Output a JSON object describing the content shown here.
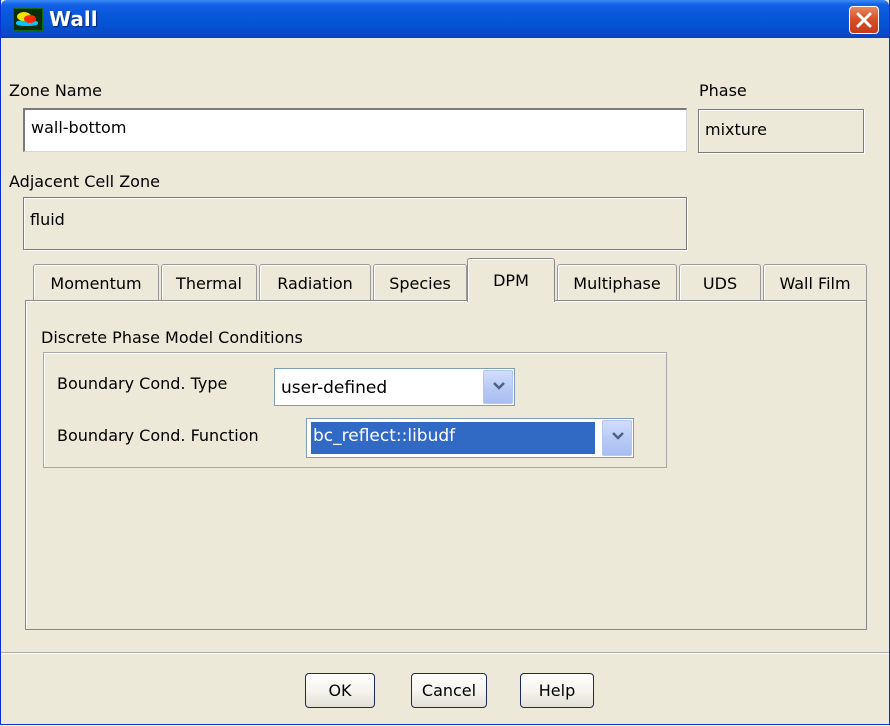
{
  "window": {
    "title": "Wall"
  },
  "zone_name": {
    "label": "Zone Name",
    "value": "wall-bottom"
  },
  "phase": {
    "label": "Phase",
    "value": "mixture"
  },
  "adjacent_cell_zone": {
    "label": "Adjacent Cell Zone",
    "value": "fluid"
  },
  "tabs": [
    {
      "label": "Momentum"
    },
    {
      "label": "Thermal"
    },
    {
      "label": "Radiation"
    },
    {
      "label": "Species"
    },
    {
      "label": "DPM",
      "active": true
    },
    {
      "label": "Multiphase"
    },
    {
      "label": "UDS"
    },
    {
      "label": "Wall Film"
    }
  ],
  "dpm": {
    "group_title": "Discrete Phase Model Conditions",
    "bc_type": {
      "label": "Boundary Cond. Type",
      "value": "user-defined"
    },
    "bc_function": {
      "label": "Boundary Cond. Function",
      "value": "bc_reflect::libudf"
    }
  },
  "buttons": {
    "ok": "OK",
    "cancel": "Cancel",
    "help": "Help"
  },
  "colors": {
    "titlebar": "#0a58dc",
    "dialog_bg": "#ece9d8",
    "selection": "#316ac5",
    "close_button": "#d8502a"
  }
}
